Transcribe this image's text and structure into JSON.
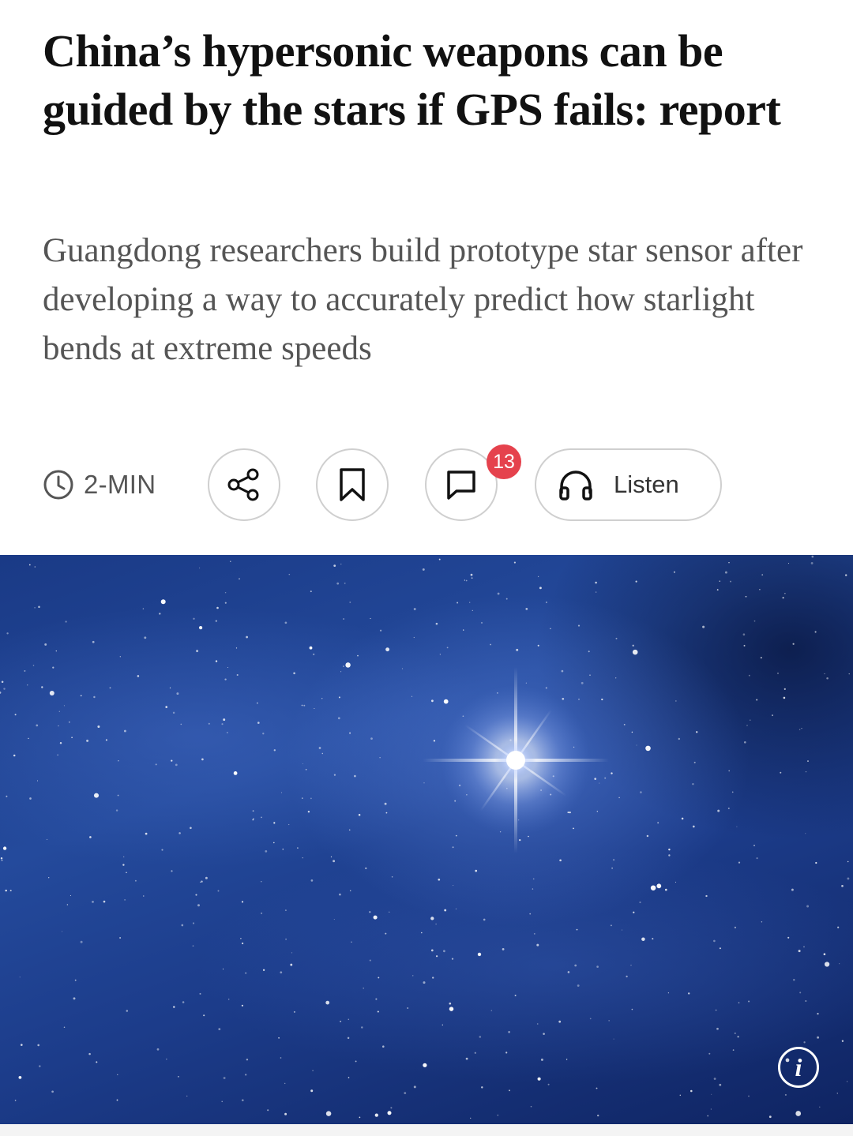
{
  "article": {
    "headline": "China’s hypersonic weapons can be guided by the stars if GPS fails: report",
    "subheadline": "Guangdong researchers build prototype star sensor after developing a way to accurately predict how starlight bends at extreme speeds"
  },
  "toolbar": {
    "read_time": "2-MIN",
    "comment_count": "13",
    "listen_label": "Listen"
  },
  "icons": {
    "read_time": "clock-icon",
    "share": "share-icon",
    "bookmark": "bookmark-icon",
    "comment": "comment-icon",
    "listen": "headphones-icon",
    "info": "info-icon"
  },
  "hero_image": {
    "info_glyph": "i"
  },
  "colors": {
    "badge": "#e5424d",
    "subheadline": "#555555",
    "sky_blue": "#1c3c8a"
  }
}
